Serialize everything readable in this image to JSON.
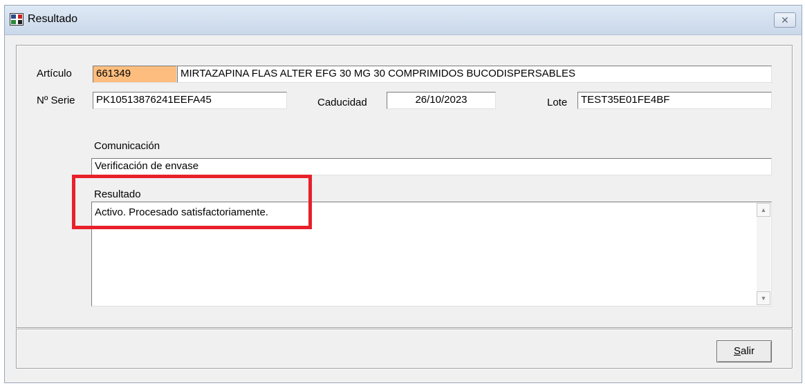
{
  "window": {
    "title": "Resultado",
    "close_glyph": "✕"
  },
  "icons": {
    "app": "app-icon",
    "close": "close-icon",
    "scroll_up": "arrow-up-icon",
    "scroll_down": "arrow-down-icon"
  },
  "form": {
    "articulo": {
      "label": "Artículo",
      "code": "661349",
      "description": "MIRTAZAPINA FLAS ALTER EFG 30 MG 30 COMPRIMIDOS BUCODISPERSABLES"
    },
    "serie": {
      "label": "Nº Serie",
      "value": "PK10513876241EEFA45"
    },
    "caducidad": {
      "label": "Caducidad",
      "value": "26/10/2023"
    },
    "lote": {
      "label": "Lote",
      "value": "TEST35E01FE4BF"
    },
    "comunicacion": {
      "label": "Comunicación",
      "value": "Verificación de envase"
    },
    "resultado": {
      "label": "Resultado",
      "value": "Activo. Procesado satisfactoriamente."
    }
  },
  "footer": {
    "salir_first": "S",
    "salir_rest": "alir"
  },
  "colors": {
    "code_field_bg": "#fdbd7e",
    "highlight": "#e8202a"
  }
}
